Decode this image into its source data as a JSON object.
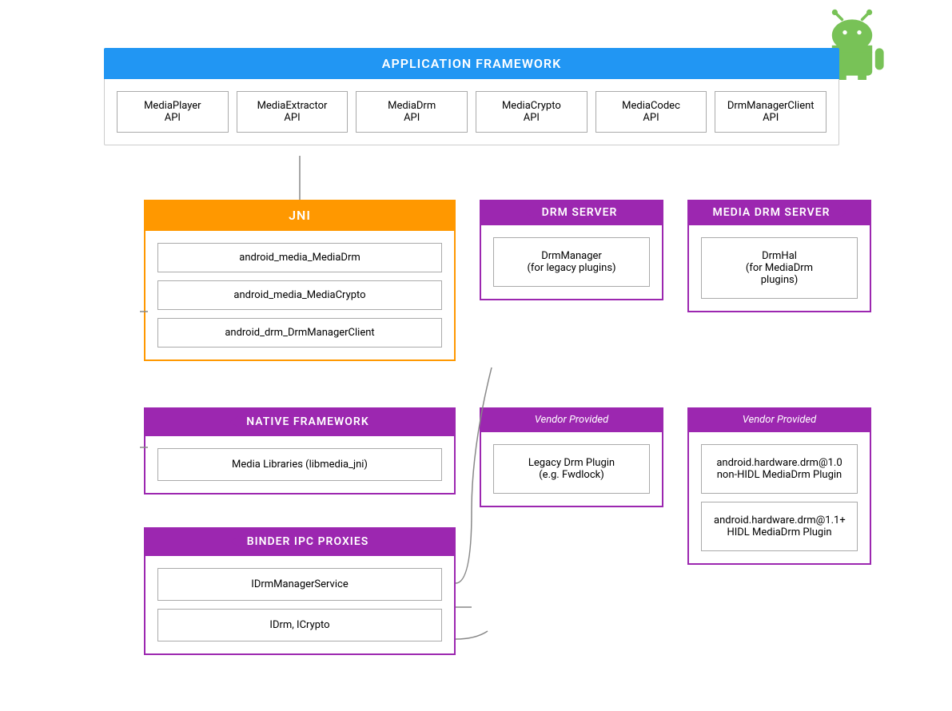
{
  "android_logo": {
    "alt": "Android Logo"
  },
  "app_framework": {
    "header": "APPLICATION FRAMEWORK",
    "apis": [
      {
        "label": "MediaPlayer\nAPI"
      },
      {
        "label": "MediaExtractor\nAPI"
      },
      {
        "label": "MediaDrm\nAPI"
      },
      {
        "label": "MediaCrypto\nAPI"
      },
      {
        "label": "MediaCodec\nAPI"
      },
      {
        "label": "DrmManagerClient\nAPI"
      }
    ]
  },
  "jni": {
    "header": "JNI",
    "items": [
      "android_media_MediaDrm",
      "android_media_MediaCrypto",
      "android_drm_DrmManagerClient"
    ]
  },
  "drm_server": {
    "header": "DRM SERVER",
    "item": "DrmManager\n(for legacy plugins)"
  },
  "media_drm_server": {
    "header": "MEDIA DRM SERVER",
    "item": "DrmHal\n(for MediaDrm\nplugins)"
  },
  "native_framework": {
    "header": "NATIVE FRAMEWORK",
    "item": "Media Libraries (libmedia_jni)"
  },
  "vendor_drm": {
    "header": "Vendor Provided",
    "item": "Legacy Drm Plugin\n(e.g. Fwdlock)"
  },
  "vendor_media_drm": {
    "header": "Vendor Provided",
    "items": [
      "android.hardware.drm@1.0\nnon-HIDL MediaDrm Plugin",
      "android.hardware.drm@1.1+\nHIDL MediaDrm Plugin"
    ]
  },
  "binder_ipc": {
    "header": "BINDER IPC PROXIES",
    "items": [
      "IDrmManagerService",
      "IDrm, ICrypto"
    ]
  }
}
